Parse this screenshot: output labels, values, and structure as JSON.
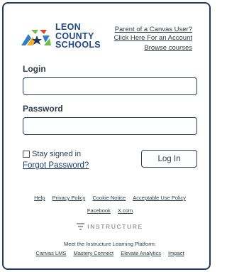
{
  "logo": {
    "line1": "LEON",
    "line2": "COUNTY",
    "line3": "SCHOOLS"
  },
  "parent": {
    "question": "Parent of a Canvas User?",
    "action": "Click Here For an Account"
  },
  "browse_link": "Browse courses",
  "form": {
    "login_label": "Login",
    "password_label": "Password",
    "stay_label": "Stay signed in",
    "forgot_link": "Forgot Password?",
    "login_button": "Log In"
  },
  "footer": {
    "links_row1": [
      "Help",
      "Privacy Policy",
      "Cookie Notice",
      "Acceptable Use Policy"
    ],
    "links_row2": [
      "Facebook",
      "X.com"
    ],
    "instructure": "INSTRUCTURE",
    "meet": "Meet the Instructure Learning Platform:",
    "platform_links": [
      "Canvas LMS",
      "Mastery Connect",
      "Elevate Analytics",
      "Impact"
    ]
  },
  "colors": {
    "navy": "#1f3a66",
    "text": "#2d3b45"
  }
}
